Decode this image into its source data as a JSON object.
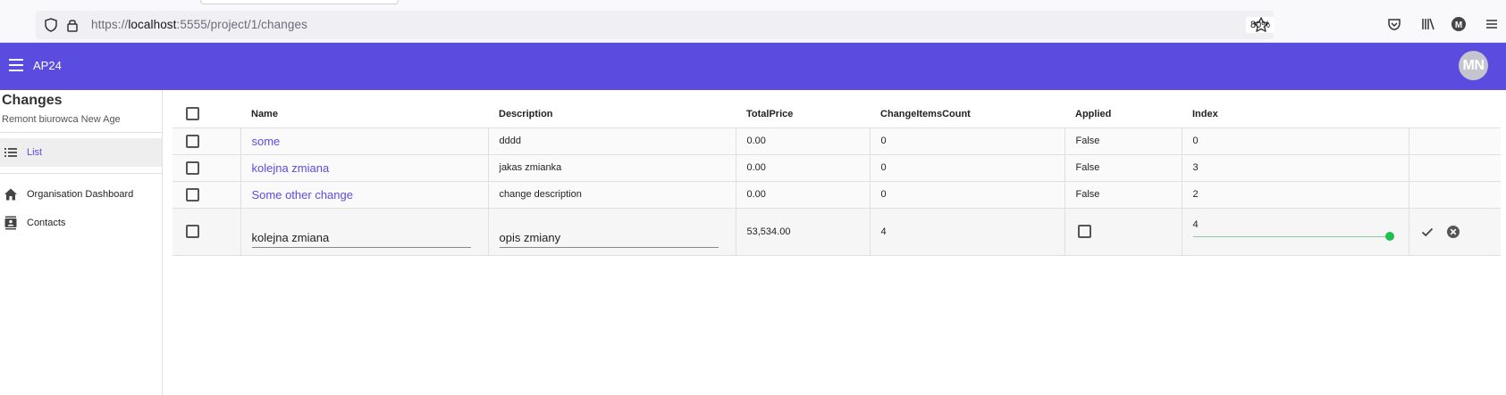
{
  "browser": {
    "url_prefix": "https://",
    "url_host": "localhost",
    "url_rest": ":5555/project/1/changes",
    "zoom": "80%"
  },
  "app": {
    "brand": "AP24",
    "avatar_initials": "MN",
    "accent_color": "#5b4ce0"
  },
  "sidebar": {
    "title": "Changes",
    "subtitle": "Remont biurowca New Age",
    "items": [
      {
        "label": "List",
        "icon": "list-icon"
      },
      {
        "label": "Organisation Dashboard",
        "icon": "home-icon"
      },
      {
        "label": "Contacts",
        "icon": "contacts-icon"
      }
    ]
  },
  "grid": {
    "columns": [
      "Name",
      "Description",
      "TotalPrice",
      "ChangeItemsCount",
      "Applied",
      "Index"
    ],
    "rows": [
      {
        "name": "some",
        "description": "dddd",
        "total_price": "0.00",
        "count": "0",
        "applied": "False",
        "index": "0"
      },
      {
        "name": "kolejna zmiana",
        "description": "jakas zmianka",
        "total_price": "0.00",
        "count": "0",
        "applied": "False",
        "index": "3"
      },
      {
        "name": "Some other change",
        "description": "change description",
        "total_price": "0.00",
        "count": "0",
        "applied": "False",
        "index": "2"
      }
    ],
    "edit_row": {
      "name_value": "kolejna zmiana",
      "description_value": "opis zmiany",
      "total_price": "53,534.00",
      "count": "4",
      "applied_checked": false,
      "index_value": "4",
      "index_slider_fraction": 1.0,
      "slider_color": "#20c050"
    }
  }
}
